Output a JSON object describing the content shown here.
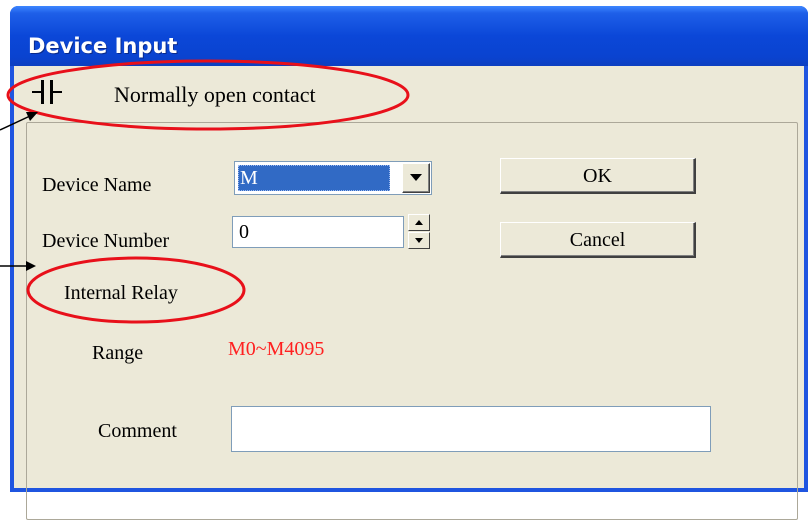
{
  "window": {
    "title": "Device Input"
  },
  "contact": {
    "label": "Normally open contact",
    "icon": "normally-open-contact-icon"
  },
  "form": {
    "device_name_label": "Device Name",
    "device_name_value": "M",
    "device_number_label": "Device Number",
    "device_number_value": "0",
    "device_type": "Internal Relay",
    "range_label": "Range",
    "range_value": "M0~M4095",
    "comment_label": "Comment",
    "comment_value": ""
  },
  "buttons": {
    "ok": "OK",
    "cancel": "Cancel"
  },
  "colors": {
    "titlebar": "#0a43d0",
    "dialog_bg": "#ece9d8",
    "selection": "#316ac5",
    "range_text": "#ff2020",
    "annotation": "#e8101a"
  }
}
